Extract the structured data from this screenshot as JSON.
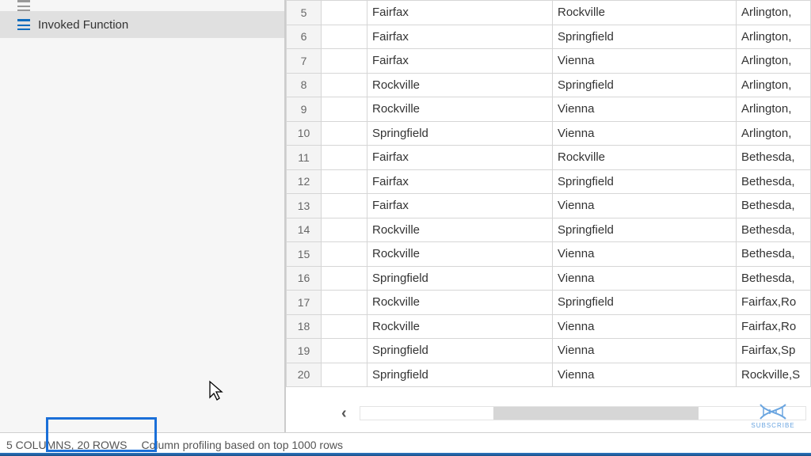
{
  "sidebar": {
    "queries": [
      {
        "label": ""
      },
      {
        "label": "Invoked Function"
      }
    ],
    "selected_index": 1
  },
  "grid": {
    "rows": [
      {
        "n": 5,
        "a": "Fairfax",
        "b": "Rockville",
        "c": "Arlington,"
      },
      {
        "n": 6,
        "a": "Fairfax",
        "b": "Springfield",
        "c": "Arlington,"
      },
      {
        "n": 7,
        "a": "Fairfax",
        "b": "Vienna",
        "c": "Arlington,"
      },
      {
        "n": 8,
        "a": "Rockville",
        "b": "Springfield",
        "c": "Arlington,"
      },
      {
        "n": 9,
        "a": "Rockville",
        "b": "Vienna",
        "c": "Arlington,"
      },
      {
        "n": 10,
        "a": "Springfield",
        "b": "Vienna",
        "c": "Arlington,"
      },
      {
        "n": 11,
        "a": "Fairfax",
        "b": "Rockville",
        "c": "Bethesda,"
      },
      {
        "n": 12,
        "a": "Fairfax",
        "b": "Springfield",
        "c": "Bethesda,"
      },
      {
        "n": 13,
        "a": "Fairfax",
        "b": "Vienna",
        "c": "Bethesda,"
      },
      {
        "n": 14,
        "a": "Rockville",
        "b": "Springfield",
        "c": "Bethesda,"
      },
      {
        "n": 15,
        "a": "Rockville",
        "b": "Vienna",
        "c": "Bethesda,"
      },
      {
        "n": 16,
        "a": "Springfield",
        "b": "Vienna",
        "c": "Bethesda,"
      },
      {
        "n": 17,
        "a": "Rockville",
        "b": "Springfield",
        "c": "Fairfax,Ro"
      },
      {
        "n": 18,
        "a": "Rockville",
        "b": "Vienna",
        "c": "Fairfax,Ro"
      },
      {
        "n": 19,
        "a": "Springfield",
        "b": "Vienna",
        "c": "Fairfax,Sp"
      },
      {
        "n": 20,
        "a": "Springfield",
        "b": "Vienna",
        "c": "Rockville,S"
      }
    ]
  },
  "statusbar": {
    "counts": "5 COLUMNS, 20 ROWS",
    "profiling": "Column profiling based on top 1000 rows"
  },
  "watermark": {
    "label": "SUBSCRIBE"
  },
  "colors": {
    "accent": "#1a6fd8",
    "row_index_bg": "#f4f4f4",
    "grid_border": "#d6d6d6"
  }
}
